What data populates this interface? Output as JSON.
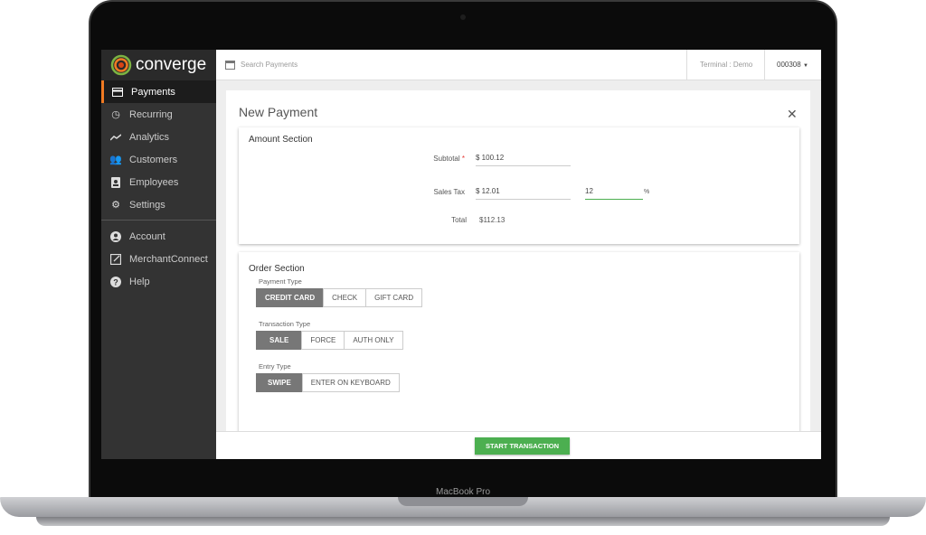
{
  "device": {
    "label": "MacBook Pro"
  },
  "app": {
    "brand": "converge",
    "accent": "#f07a22",
    "success": "#4caf50"
  },
  "sidebar": {
    "items": [
      {
        "label": "Payments",
        "icon": "credit-card-icon"
      },
      {
        "label": "Recurring",
        "icon": "clock-icon"
      },
      {
        "label": "Analytics",
        "icon": "trending-icon"
      },
      {
        "label": "Customers",
        "icon": "people-icon"
      },
      {
        "label": "Employees",
        "icon": "badge-icon"
      },
      {
        "label": "Settings",
        "icon": "gear-icon"
      },
      {
        "label": "Account",
        "icon": "account-icon"
      },
      {
        "label": "MerchantConnect",
        "icon": "external-link-icon"
      },
      {
        "label": "Help",
        "icon": "help-icon"
      }
    ]
  },
  "topbar": {
    "search_placeholder": "Search Payments",
    "terminal": "Terminal : Demo",
    "account": "000308"
  },
  "page": {
    "title": "New Payment"
  },
  "amount": {
    "heading": "Amount Section",
    "subtotal_label": "Subtotal",
    "required": "*",
    "subtotal": "$ 100.12",
    "tax_label": "Sales Tax",
    "tax": "$ 12.01",
    "tax_rate": "12",
    "percent": "%",
    "total_label": "Total",
    "total": "$112.13"
  },
  "order": {
    "heading": "Order Section",
    "payment_type": {
      "label": "Payment Type",
      "options": [
        "CREDIT CARD",
        "CHECK",
        "GIFT CARD"
      ],
      "selected": "CREDIT CARD"
    },
    "transaction_type": {
      "label": "Transaction Type",
      "options": [
        "SALE",
        "FORCE",
        "AUTH ONLY"
      ],
      "selected": "SALE"
    },
    "entry_type": {
      "label": "Entry Type",
      "options": [
        "SWIPE",
        "ENTER ON KEYBOARD"
      ],
      "selected": "SWIPE"
    }
  },
  "footer": {
    "start_label": "START TRANSACTION"
  }
}
